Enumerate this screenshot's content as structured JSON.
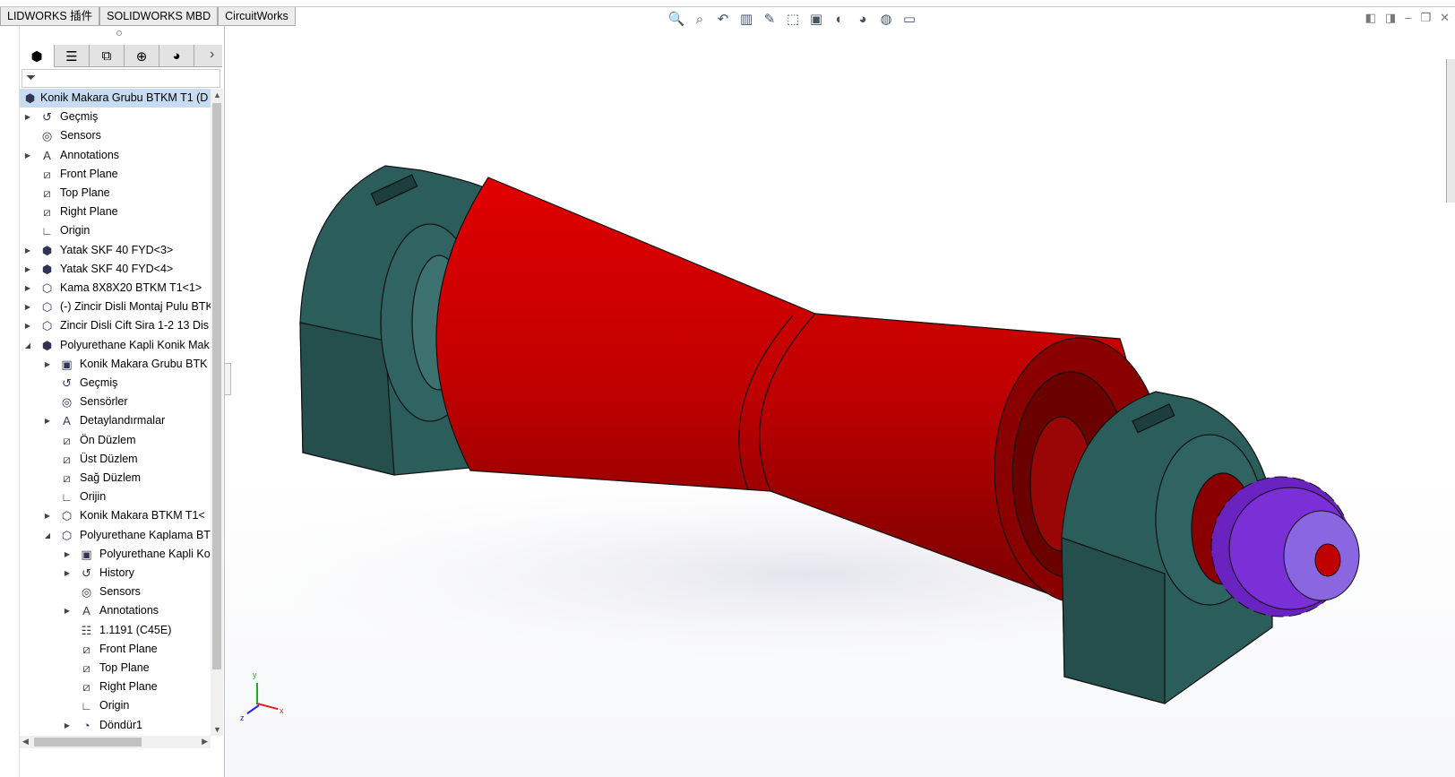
{
  "command_tabs": [
    "LIDWORKS 插件",
    "SOLIDWORKS MBD",
    "CircuitWorks"
  ],
  "panel_tabs": [
    {
      "name": "feature-manager",
      "glyph": "⬢"
    },
    {
      "name": "property-manager",
      "glyph": "☰"
    },
    {
      "name": "configuration-manager",
      "glyph": "⧉"
    },
    {
      "name": "dimxpert-manager",
      "glyph": "⊕"
    },
    {
      "name": "display-manager",
      "glyph": "◕"
    }
  ],
  "panel_more": "›",
  "filter_glyph": "⏷",
  "tree": [
    {
      "level": 0,
      "label": "Konik Makara Grubu BTKM T1  (D",
      "icon": "assembly",
      "exp": "",
      "selected": true
    },
    {
      "level": 0,
      "label": "Geçmiş",
      "icon": "history",
      "exp": "collapsed"
    },
    {
      "level": 0,
      "label": "Sensors",
      "icon": "sensor",
      "exp": ""
    },
    {
      "level": 0,
      "label": "Annotations",
      "icon": "annotation",
      "exp": "collapsed"
    },
    {
      "level": 0,
      "label": "Front Plane",
      "icon": "plane",
      "exp": ""
    },
    {
      "level": 0,
      "label": "Top Plane",
      "icon": "plane",
      "exp": ""
    },
    {
      "level": 0,
      "label": "Right Plane",
      "icon": "plane",
      "exp": ""
    },
    {
      "level": 0,
      "label": "Origin",
      "icon": "origin",
      "exp": ""
    },
    {
      "level": 0,
      "label": "Yatak SKF 40 FYD<3>",
      "icon": "assembly",
      "exp": "collapsed"
    },
    {
      "level": 0,
      "label": "Yatak SKF 40 FYD<4>",
      "icon": "assembly",
      "exp": "collapsed"
    },
    {
      "level": 0,
      "label": "Kama 8X8X20 BTKM T1<1>",
      "icon": "part",
      "exp": "collapsed"
    },
    {
      "level": 0,
      "label": "(-) Zincir Disli Montaj Pulu BTK",
      "icon": "part",
      "exp": "collapsed"
    },
    {
      "level": 0,
      "label": "Zincir Disli Cift Sira 1-2 13 Dis",
      "icon": "part",
      "exp": "collapsed"
    },
    {
      "level": 0,
      "label": "Polyurethane Kapli Konik Mak",
      "icon": "assembly",
      "exp": "expanded"
    },
    {
      "level": 1,
      "label": "Konik Makara Grubu BTK",
      "icon": "folder",
      "exp": "collapsed"
    },
    {
      "level": 1,
      "label": "Geçmiş",
      "icon": "history",
      "exp": ""
    },
    {
      "level": 1,
      "label": "Sensörler",
      "icon": "sensor",
      "exp": ""
    },
    {
      "level": 1,
      "label": "Detaylandırmalar",
      "icon": "annotation",
      "exp": "collapsed"
    },
    {
      "level": 1,
      "label": "Ön Düzlem",
      "icon": "plane",
      "exp": ""
    },
    {
      "level": 1,
      "label": "Üst Düzlem",
      "icon": "plane",
      "exp": ""
    },
    {
      "level": 1,
      "label": "Sağ Düzlem",
      "icon": "plane",
      "exp": ""
    },
    {
      "level": 1,
      "label": "Orijin",
      "icon": "origin",
      "exp": ""
    },
    {
      "level": 1,
      "label": "Konik Makara BTKM T1<",
      "icon": "part",
      "exp": "collapsed"
    },
    {
      "level": 1,
      "label": "Polyurethane Kaplama BT",
      "icon": "part",
      "exp": "expanded"
    },
    {
      "level": 2,
      "label": "Polyurethane Kapli Ko",
      "icon": "folder",
      "exp": "collapsed"
    },
    {
      "level": 2,
      "label": "History",
      "icon": "history",
      "exp": "collapsed"
    },
    {
      "level": 2,
      "label": "Sensors",
      "icon": "sensor",
      "exp": ""
    },
    {
      "level": 2,
      "label": "Annotations",
      "icon": "annotation",
      "exp": "collapsed"
    },
    {
      "level": 2,
      "label": "1.1191 (C45E)",
      "icon": "material",
      "exp": ""
    },
    {
      "level": 2,
      "label": "Front Plane",
      "icon": "plane",
      "exp": ""
    },
    {
      "level": 2,
      "label": "Top Plane",
      "icon": "plane",
      "exp": ""
    },
    {
      "level": 2,
      "label": "Right Plane",
      "icon": "plane",
      "exp": ""
    },
    {
      "level": 2,
      "label": "Origin",
      "icon": "origin",
      "exp": ""
    },
    {
      "level": 2,
      "label": "Döndür1",
      "icon": "revolve",
      "exp": "collapsed"
    }
  ],
  "icon_glyphs": {
    "assembly": "⬢",
    "history": "↺",
    "sensor": "◎",
    "annotation": "A",
    "plane": "⧄",
    "origin": "∟",
    "part": "⬡",
    "folder": "▣",
    "material": "☷",
    "revolve": "◔"
  },
  "view_tools": [
    "zoom-to-fit",
    "zoom-to-area",
    "previous-view",
    "section-view",
    "dynamic-annotation",
    "view-orientation",
    "display-style",
    "hide-show",
    "edit-appearance",
    "apply-scene",
    "view-settings"
  ],
  "view_tool_glyphs": [
    "🔍",
    "⌕",
    "↶",
    "▥",
    "✎",
    "⬚",
    "▣",
    "◐",
    "◕",
    "◍",
    "▭"
  ],
  "triad": {
    "x": "x",
    "y": "y",
    "z": "z"
  },
  "colors": {
    "roller": "#c40000",
    "bearing": "#2b5d5b",
    "sprocket": "#7b2fd6",
    "selection": "#c7dcf0"
  }
}
